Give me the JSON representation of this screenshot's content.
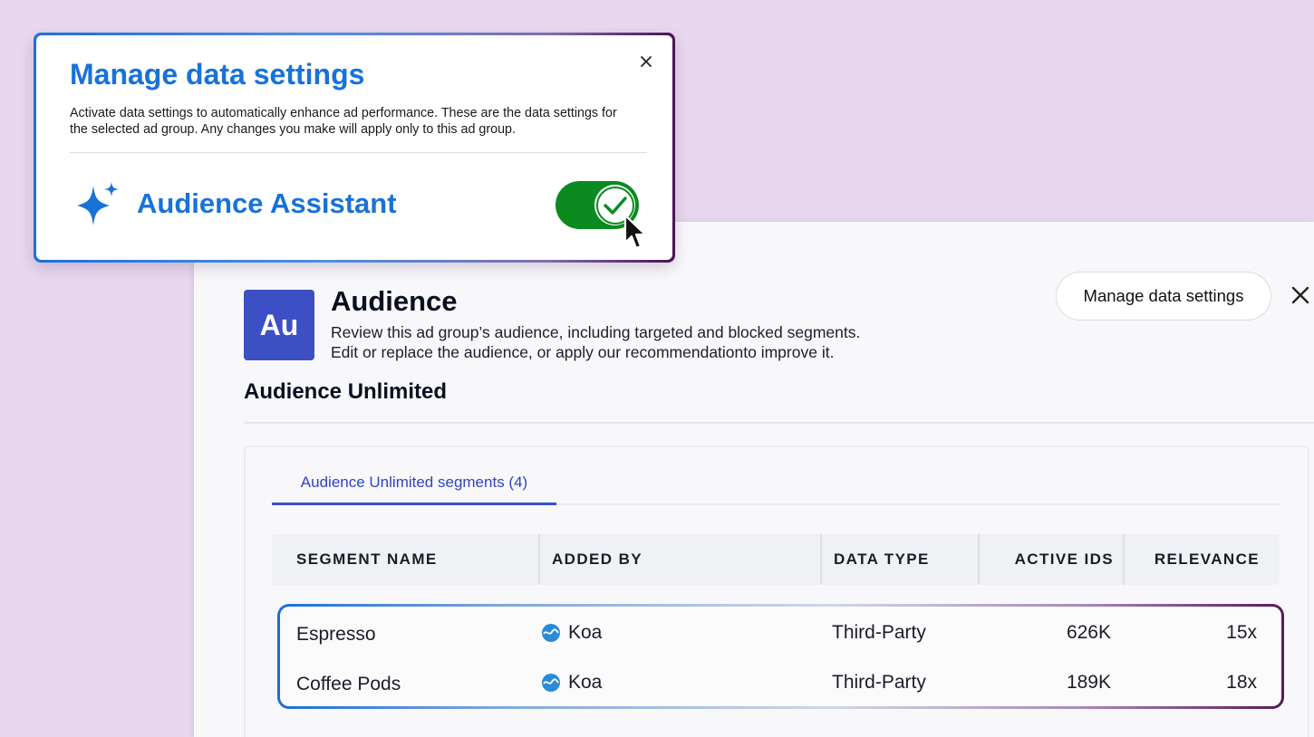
{
  "popup": {
    "title": "Manage data settings",
    "description": "Activate data settings to automatically enhance ad performance. These are the data settings for the selected ad group. Any changes you make will apply only to this ad group.",
    "feature_label": "Audience Assistant",
    "toggle_state": "on",
    "close_icon": "close-icon",
    "feature_icon": "sparkle-icon"
  },
  "panel": {
    "tile_text": "Au",
    "title": "Audience",
    "description_line1": "Review this ad group’s audience, including targeted and blocked segments.",
    "description_line2": "Edit or replace the audience, or apply our recommendationto improve it.",
    "manage_button": "Manage data settings",
    "subtitle": "Audience Unlimited",
    "tile_color": "#3d4fc4"
  },
  "tabs": [
    {
      "label": "Audience Unlimited segments (4)",
      "active": true
    }
  ],
  "table": {
    "columns": [
      "SEGMENT NAME",
      "ADDED BY",
      "DATA TYPE",
      "ACTIVE IDS",
      "RELEVANCE"
    ],
    "rows": [
      {
        "segment": "Espresso",
        "added_by": "Koa",
        "data_type": "Third-Party",
        "active_ids": "626K",
        "relevance": "15x"
      },
      {
        "segment": "Coffee Pods",
        "added_by": "Koa",
        "data_type": "Third-Party",
        "active_ids": "189K",
        "relevance": "18x"
      }
    ]
  },
  "colors": {
    "accent_blue": "#1872d8",
    "toggle_green": "#0a8a1f",
    "background": "#e8d7ef"
  }
}
